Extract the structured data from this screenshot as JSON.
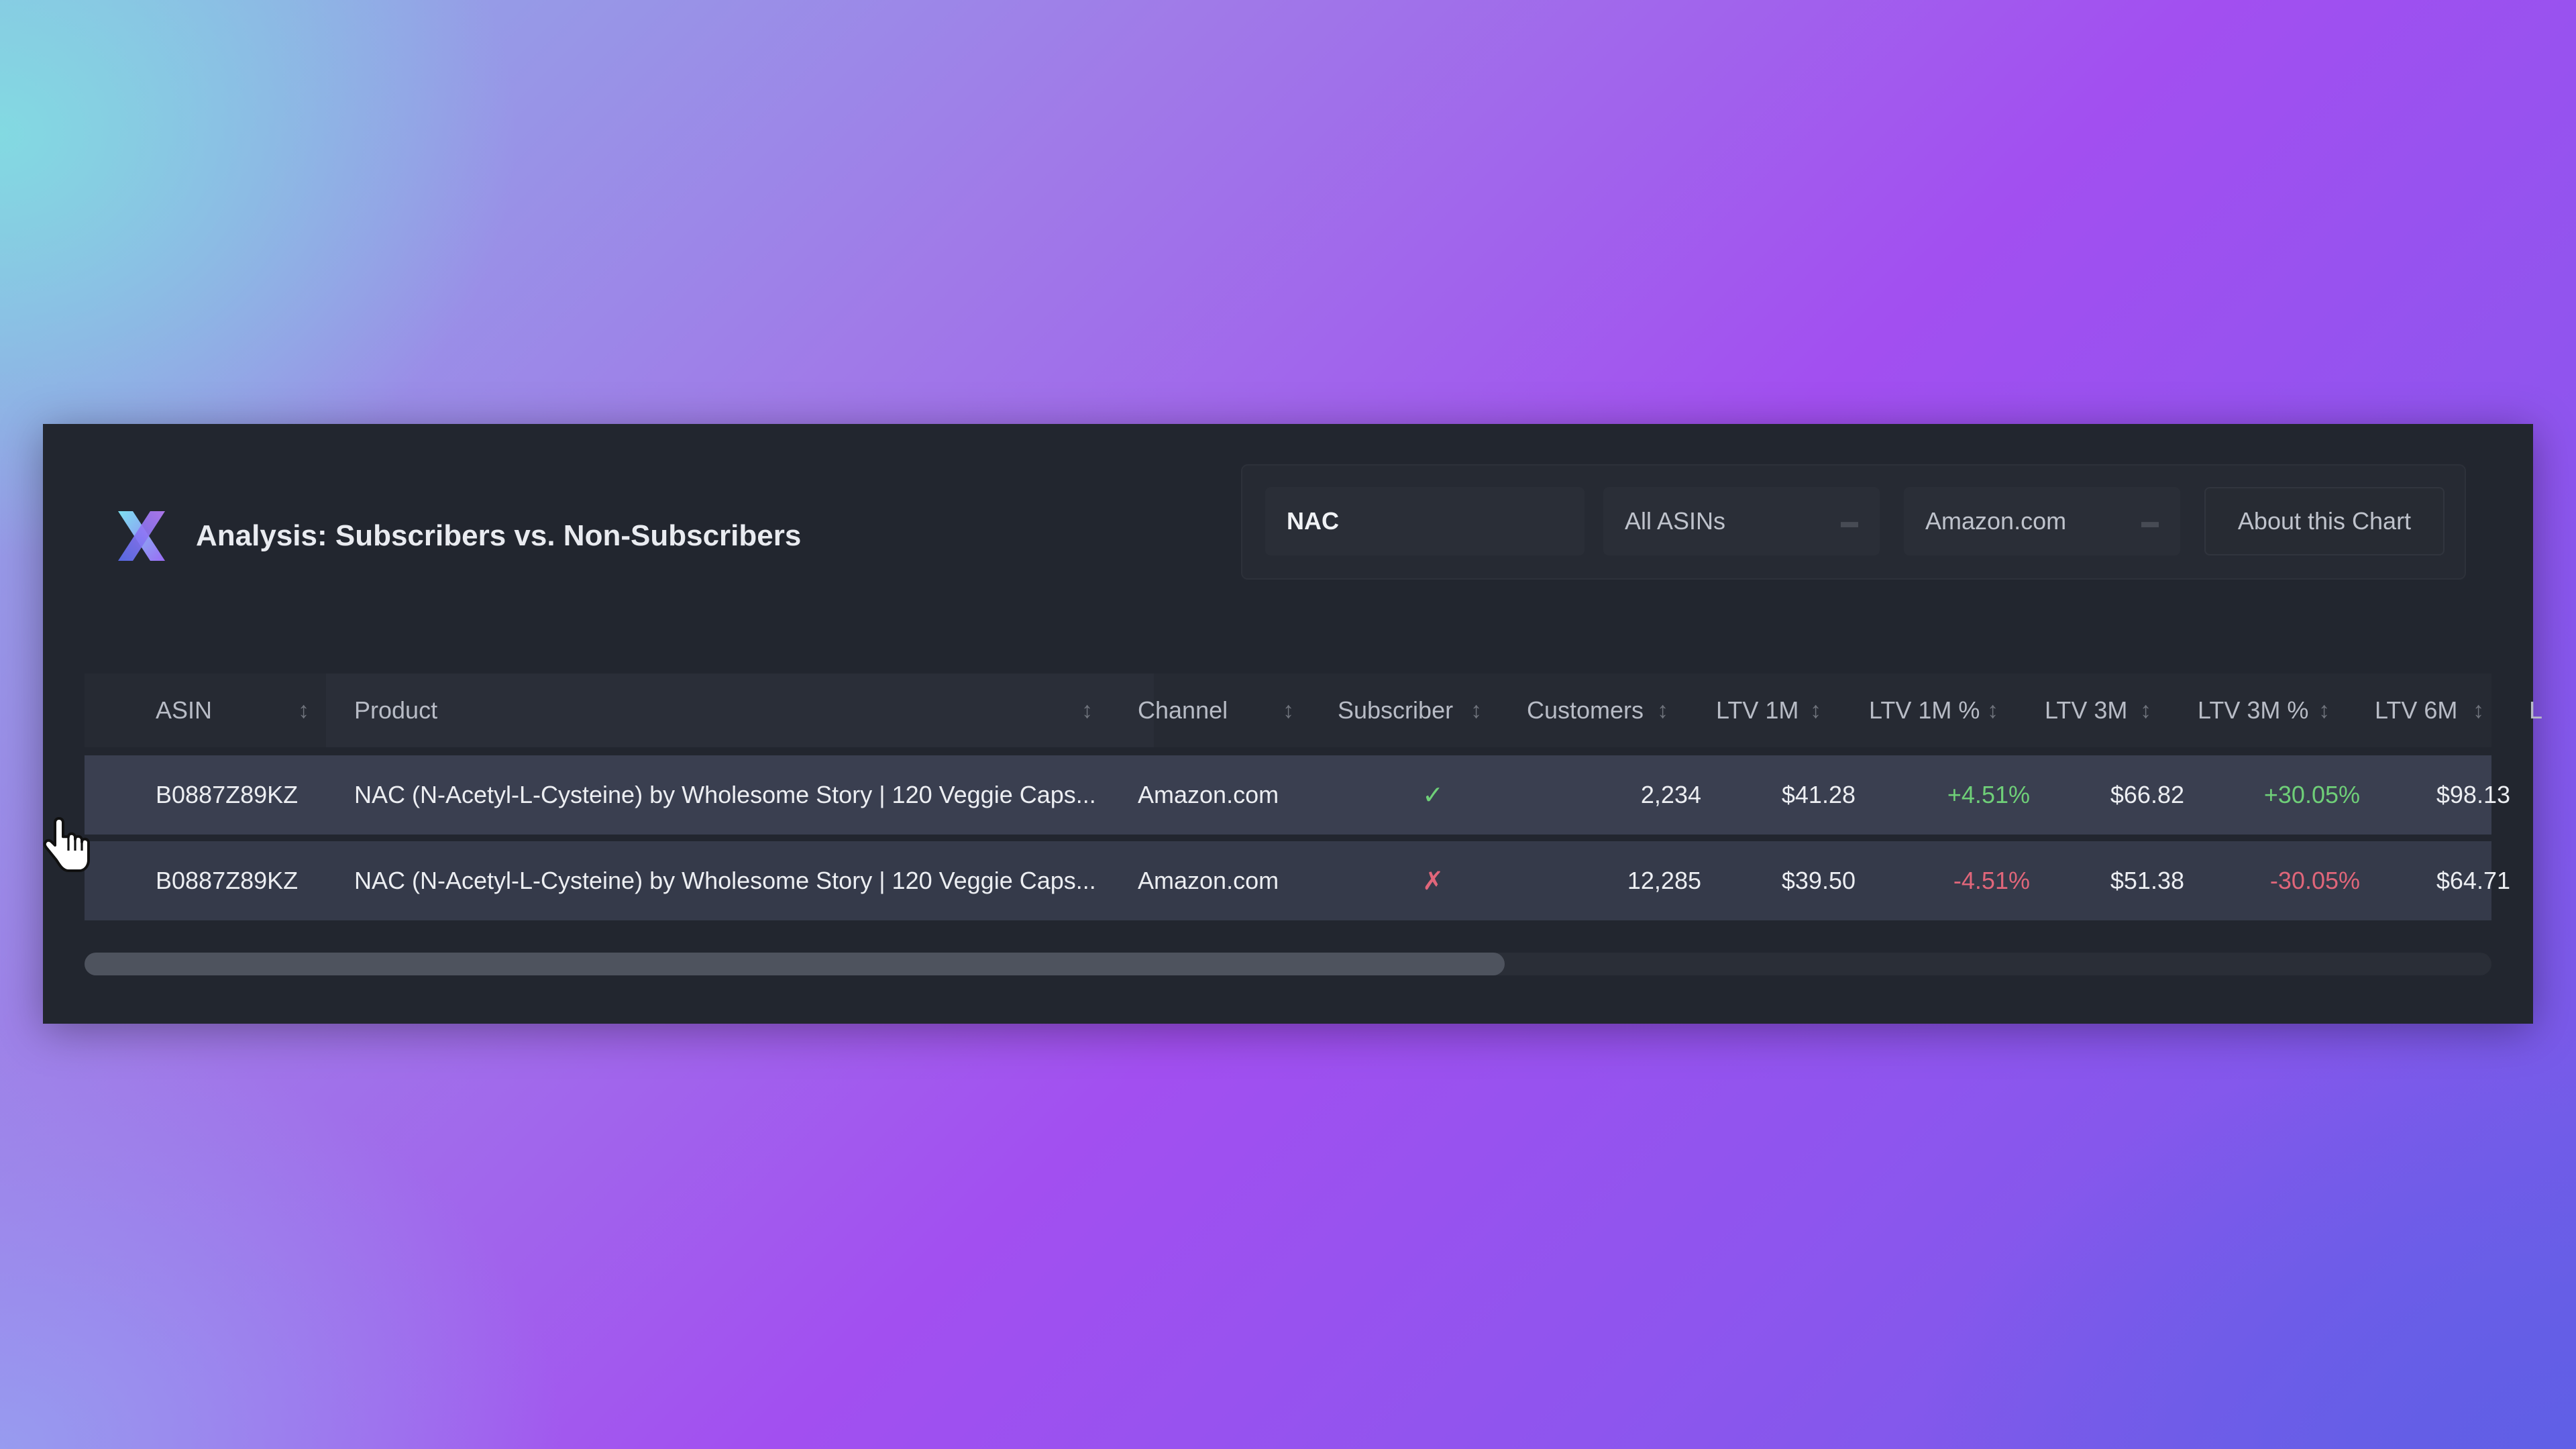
{
  "header": {
    "title": "Analysis: Subscribers vs. Non-Subscribers",
    "logo_icon": "x-logo-icon"
  },
  "controls": {
    "search_value": "NAC",
    "asin_select": "All ASINs",
    "channel_select": "Amazon.com",
    "about_button": "About this Chart"
  },
  "table": {
    "columns": [
      "ASIN",
      "Product",
      "Channel",
      "Subscriber",
      "Customers",
      "LTV 1M",
      "LTV 1M %",
      "LTV 3M",
      "LTV 3M %",
      "LTV 6M",
      "L"
    ],
    "rows": [
      {
        "asin": "B0887Z89KZ",
        "product": "NAC (N-Acetyl-L-Cysteine) by Wholesome Story | 120 Veggie Caps...",
        "channel": "Amazon.com",
        "subscriber": "✓",
        "customers": "2,234",
        "ltv_1m": "$41.28",
        "ltv_1m_pct": "+4.51%",
        "ltv_3m": "$66.82",
        "ltv_3m_pct": "+30.05%",
        "ltv_6m": "$98.13"
      },
      {
        "asin": "B0887Z89KZ",
        "product": "NAC (N-Acetyl-L-Cysteine) by Wholesome Story | 120 Veggie Caps...",
        "channel": "Amazon.com",
        "subscriber": "✗",
        "customers": "12,285",
        "ltv_1m": "$39.50",
        "ltv_1m_pct": "-4.51%",
        "ltv_3m": "$51.38",
        "ltv_3m_pct": "-30.05%",
        "ltv_6m": "$64.71"
      }
    ]
  },
  "scrollbar": {
    "visible_fraction": 0.59
  },
  "colors": {
    "panel_bg": "#22262f",
    "positive": "#6fcf78",
    "negative": "#e0667a"
  }
}
